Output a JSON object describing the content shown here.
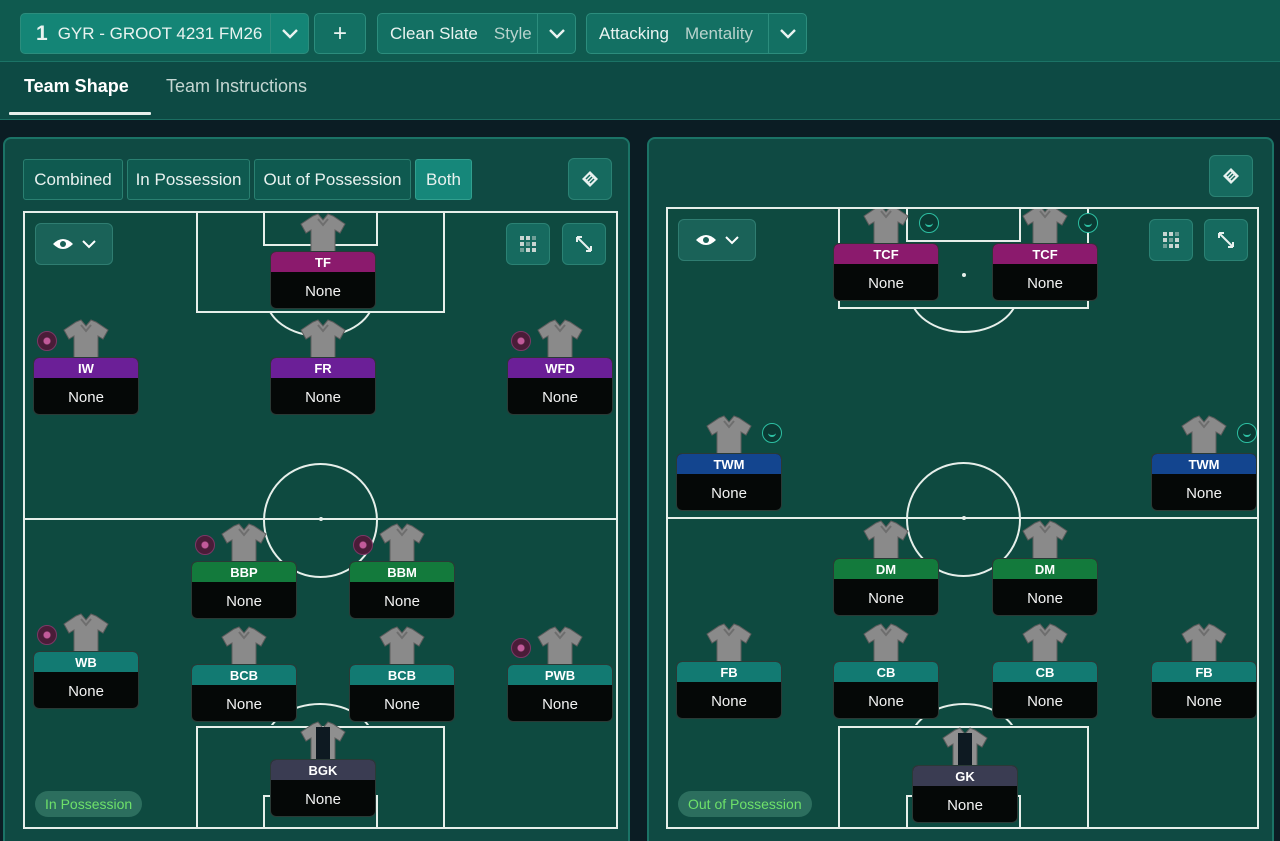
{
  "header": {
    "tactic_number": "1",
    "tactic_name": "GYR - GROOT 4231 FM26",
    "add_label": "+",
    "style_value": "Clean Slate",
    "style_label": "Style",
    "mentality_value": "Attacking",
    "mentality_label": "Mentality"
  },
  "tabs": [
    {
      "label": "Team Shape",
      "active": true
    },
    {
      "label": "Team Instructions",
      "active": false
    }
  ],
  "view_modes": [
    {
      "label": "Combined",
      "active": false
    },
    {
      "label": "In Possession",
      "active": false
    },
    {
      "label": "Out of Possession",
      "active": false
    },
    {
      "label": "Both",
      "active": true
    }
  ],
  "colors": {
    "attack_role": "#8b1a6d",
    "wide_role": "#6b1f97",
    "wide_def_role": "#13458f",
    "mid_role": "#137a3c",
    "def_role": "#127a72",
    "gk_role": "#3a3c52"
  },
  "left_pitch": {
    "phase_label": "In Possession",
    "players": [
      {
        "role": "TF",
        "name": "None",
        "color": "#8b1a6d",
        "badge": "none"
      },
      {
        "role": "IW",
        "name": "None",
        "color": "#6b1f97",
        "badge": "pink"
      },
      {
        "role": "FR",
        "name": "None",
        "color": "#6b1f97",
        "badge": "none"
      },
      {
        "role": "WFD",
        "name": "None",
        "color": "#6b1f97",
        "badge": "pink"
      },
      {
        "role": "BBP",
        "name": "None",
        "color": "#137a3c",
        "badge": "pink"
      },
      {
        "role": "BBM",
        "name": "None",
        "color": "#137a3c",
        "badge": "pink"
      },
      {
        "role": "WB",
        "name": "None",
        "color": "#127a72",
        "badge": "pink"
      },
      {
        "role": "BCB",
        "name": "None",
        "color": "#127a72",
        "badge": "none"
      },
      {
        "role": "BCB",
        "name": "None",
        "color": "#127a72",
        "badge": "none"
      },
      {
        "role": "PWB",
        "name": "None",
        "color": "#127a72",
        "badge": "pink"
      },
      {
        "role": "BGK",
        "name": "None",
        "color": "#3a3c52",
        "badge": "none"
      }
    ]
  },
  "right_pitch": {
    "phase_label": "Out of Possession",
    "players": [
      {
        "role": "TCF",
        "name": "None",
        "color": "#8b1a6d",
        "badge": "teal"
      },
      {
        "role": "TCF",
        "name": "None",
        "color": "#8b1a6d",
        "badge": "teal"
      },
      {
        "role": "TWM",
        "name": "None",
        "color": "#13458f",
        "badge": "teal"
      },
      {
        "role": "TWM",
        "name": "None",
        "color": "#13458f",
        "badge": "teal"
      },
      {
        "role": "DM",
        "name": "None",
        "color": "#137a3c",
        "badge": "none"
      },
      {
        "role": "DM",
        "name": "None",
        "color": "#137a3c",
        "badge": "none"
      },
      {
        "role": "FB",
        "name": "None",
        "color": "#127a72",
        "badge": "none"
      },
      {
        "role": "CB",
        "name": "None",
        "color": "#127a72",
        "badge": "none"
      },
      {
        "role": "CB",
        "name": "None",
        "color": "#127a72",
        "badge": "none"
      },
      {
        "role": "FB",
        "name": "None",
        "color": "#127a72",
        "badge": "none"
      },
      {
        "role": "GK",
        "name": "None",
        "color": "#3a3c52",
        "badge": "none"
      }
    ]
  },
  "icons": [
    "chevron-down-icon",
    "plus-icon",
    "eye-icon",
    "grid-icon",
    "expand-icon",
    "pitch-toggle-icon",
    "shirt-icon"
  ]
}
